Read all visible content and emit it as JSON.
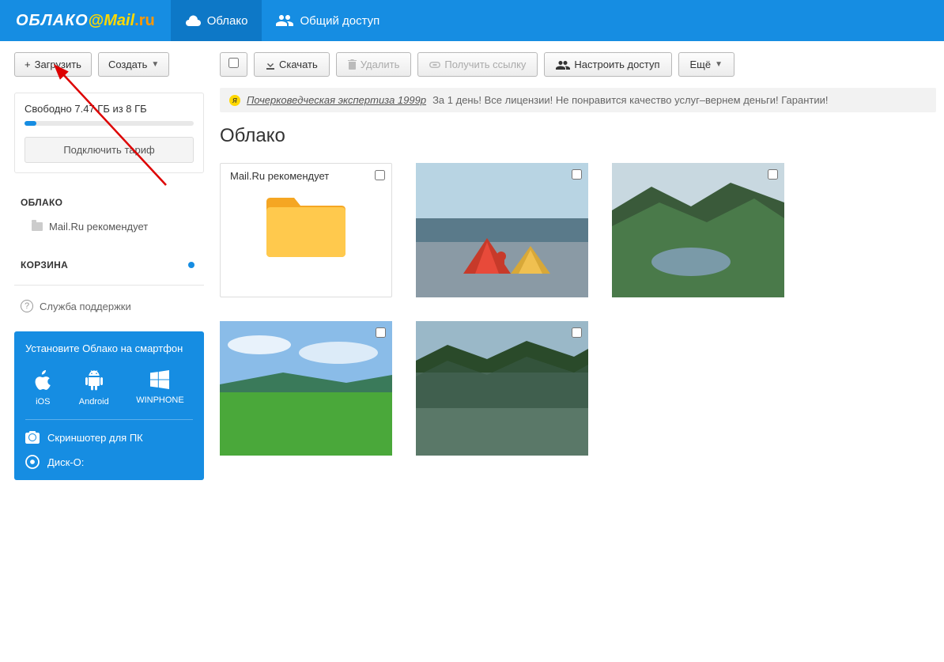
{
  "header": {
    "logo_oblako": "ОБЛАКО",
    "logo_mail": "Mail",
    "logo_ru": ".ru",
    "tabs": [
      {
        "label": "Облако",
        "active": true
      },
      {
        "label": "Общий доступ",
        "active": false
      }
    ]
  },
  "sidebar": {
    "upload_label": "Загрузить",
    "create_label": "Создать",
    "storage_text": "Свободно 7.47 ГБ из 8 ГБ",
    "tariff_label": "Подключить тариф",
    "cloud_heading": "ОБЛАКО",
    "cloud_item": "Mail.Ru рекомендует",
    "trash_heading": "КОРЗИНА",
    "support_label": "Служба поддержки",
    "promo_title": "Установите Облако на смартфон",
    "platforms": [
      {
        "label": "iOS"
      },
      {
        "label": "Android"
      },
      {
        "label": "WINPHONE"
      }
    ],
    "screenshoter_label": "Скриншотер для ПК",
    "disko_label": "Диск-О:"
  },
  "toolbar": {
    "download_label": "Скачать",
    "delete_label": "Удалить",
    "link_label": "Получить ссылку",
    "access_label": "Настроить доступ",
    "more_label": "Ещё"
  },
  "ad": {
    "link_text": "Почерковедческая экспертиза 1999р",
    "tail_text": " За 1 день! Все лицензии! Не понравится качество услуг–вернем деньги! Гарантии!"
  },
  "page_title": "Облако",
  "tiles": {
    "folder_label": "Mail.Ru рекомендует"
  }
}
